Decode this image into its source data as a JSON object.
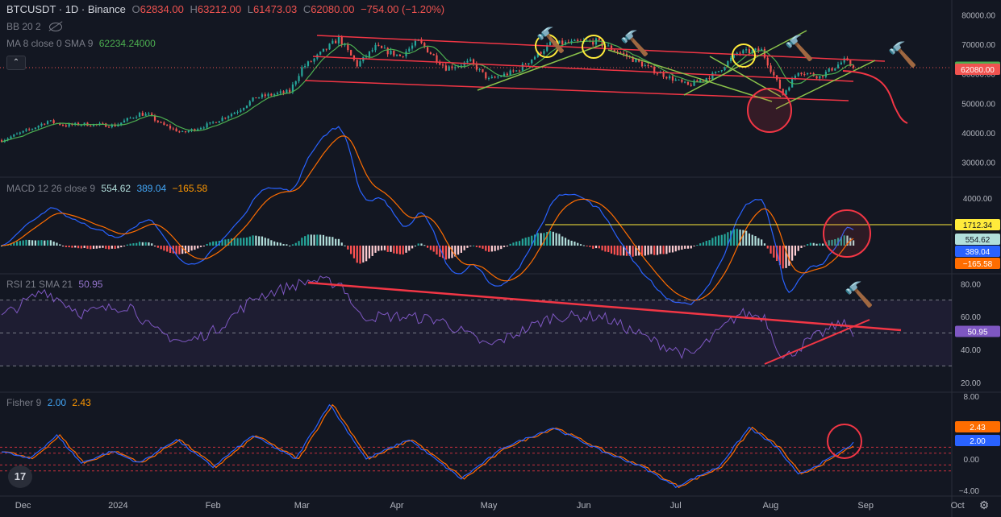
{
  "header": {
    "symbol": "BTCUSDT · 1D · Binance",
    "open_label": "O",
    "open": "62834.00",
    "high_label": "H",
    "high": "63212.00",
    "low_label": "L",
    "low": "61473.03",
    "close_label": "C",
    "close": "62080.00",
    "change": "−754.00 (−1.20%)"
  },
  "indicators": {
    "bb": "BB 20 2",
    "ma": "MA 8 close 0 SMA 9",
    "ma_value": "62234.24000",
    "macd": "MACD 12 26 close 9",
    "macd_v1": "554.62",
    "macd_v2": "389.04",
    "macd_v3": "−165.58",
    "rsi": "RSI 21 SMA 21",
    "rsi_value": "50.95",
    "fisher": "Fisher 9",
    "fisher_v1": "2.00",
    "fisher_v2": "2.43"
  },
  "logo_text": "17",
  "colors": {
    "background": "#131722",
    "up": "#26a69a",
    "down": "#ef5350",
    "channel": "#f23645",
    "trend_green": "#8bc34a",
    "ma": "#4caf50",
    "macd": "#2962ff",
    "signal": "#ff6d00",
    "rsi": "#7e57c2",
    "fisher": "#2962ff",
    "trigger": "#ff6d00",
    "highlight_circle": "#f23645",
    "yellow_circle": "#ffeb3b",
    "level_line": "#ffeb3b"
  },
  "chart_data": [
    {
      "type": "candlestick",
      "title": "BTCUSDT · 1D · Binance",
      "x_ticks": [
        "Dec",
        "2024",
        "Feb",
        "Mar",
        "Apr",
        "May",
        "Jun",
        "Jul",
        "Aug",
        "Sep",
        "Oct"
      ],
      "y_ticks": [
        "80000.00",
        "70000.00",
        "60000.00",
        "50000.00",
        "40000.00",
        "30000.00"
      ],
      "ylim": [
        25000,
        85000
      ],
      "close_path": [
        [
          "2023-11-24",
          37500
        ],
        [
          "2023-12-04",
          41500
        ],
        [
          "2023-12-09",
          44000
        ],
        [
          "2023-12-15",
          42500
        ],
        [
          "2023-12-20",
          43000
        ],
        [
          "2023-12-31",
          42500
        ],
        [
          "2024-01-08",
          46500
        ],
        [
          "2024-01-11",
          46000
        ],
        [
          "2024-01-15",
          43000
        ],
        [
          "2024-01-22",
          40000
        ],
        [
          "2024-01-31",
          43000
        ],
        [
          "2024-02-09",
          47500
        ],
        [
          "2024-02-15",
          52000
        ],
        [
          "2024-02-26",
          54000
        ],
        [
          "2024-03-01",
          62000
        ],
        [
          "2024-03-05",
          65000
        ],
        [
          "2024-03-13",
          72000
        ],
        [
          "2024-03-19",
          63000
        ],
        [
          "2024-03-25",
          69000
        ],
        [
          "2024-04-02",
          66000
        ],
        [
          "2024-04-08",
          71000
        ],
        [
          "2024-04-17",
          62000
        ],
        [
          "2024-04-25",
          64000
        ],
        [
          "2024-05-01",
          58000
        ],
        [
          "2024-05-10",
          61000
        ],
        [
          "2024-05-21",
          70000
        ],
        [
          "2024-06-05",
          71000
        ],
        [
          "2024-06-15",
          66000
        ],
        [
          "2024-06-24",
          61000
        ],
        [
          "2024-07-05",
          56000
        ],
        [
          "2024-07-14",
          60000
        ],
        [
          "2024-07-21",
          67000
        ],
        [
          "2024-07-29",
          68000
        ],
        [
          "2024-08-05",
          53000
        ],
        [
          "2024-08-10",
          61000
        ],
        [
          "2024-08-17",
          59000
        ],
        [
          "2024-08-25",
          64500
        ],
        [
          "2024-08-28",
          62080
        ]
      ],
      "ohlc_last": {
        "open": 62834.0,
        "high": 63212.0,
        "low": 61473.03,
        "close": 62080.0
      },
      "ma_last": 62234.24,
      "price_labels": [
        "62234.2400",
        "62080.00"
      ]
    },
    {
      "type": "line",
      "title": "MACD 12 26 close 9",
      "series": [
        {
          "name": "MACD",
          "last": 389.04
        },
        {
          "name": "Signal",
          "last": 554.62
        },
        {
          "name": "Histogram",
          "last": -165.58
        }
      ],
      "y_ticks": [
        "4000.00"
      ],
      "level": 1712.34,
      "price_labels": [
        "1712.34",
        "554.62",
        "389.04",
        "−165.58"
      ]
    },
    {
      "type": "line",
      "title": "RSI 21 SMA 21",
      "series": [
        {
          "name": "RSI",
          "last": 50.95
        }
      ],
      "y_ticks": [
        "80.00",
        "60.00",
        "40.00",
        "20.00"
      ],
      "ylim": [
        14,
        86
      ],
      "bands": [
        30,
        70
      ],
      "mid": 50,
      "path": [
        [
          "2023-11-24",
          60
        ],
        [
          "2023-12-08",
          76
        ],
        [
          "2023-12-20",
          62
        ],
        [
          "2024-01-05",
          67
        ],
        [
          "2024-01-12",
          52
        ],
        [
          "2024-01-23",
          44
        ],
        [
          "2024-02-02",
          52
        ],
        [
          "2024-02-15",
          72
        ],
        [
          "2024-03-04",
          82
        ],
        [
          "2024-03-14",
          80
        ],
        [
          "2024-03-20",
          60
        ],
        [
          "2024-04-02",
          60
        ],
        [
          "2024-04-15",
          58
        ],
        [
          "2024-05-01",
          42
        ],
        [
          "2024-05-22",
          60
        ],
        [
          "2024-06-07",
          60
        ],
        [
          "2024-06-25",
          44
        ],
        [
          "2024-07-06",
          36
        ],
        [
          "2024-07-22",
          62
        ],
        [
          "2024-07-30",
          60
        ],
        [
          "2024-08-05",
          34
        ],
        [
          "2024-08-14",
          46
        ],
        [
          "2024-08-24",
          56
        ],
        [
          "2024-08-28",
          51
        ]
      ],
      "price_labels": [
        "50.95"
      ]
    },
    {
      "type": "line",
      "title": "Fisher 9",
      "series": [
        {
          "name": "Fisher",
          "last": 2.0
        },
        {
          "name": "Trigger",
          "last": 2.43
        }
      ],
      "y_ticks": [
        "8.00",
        "4.00",
        "0.00",
        "−4.00"
      ],
      "ylim": [
        -4.7,
        8.5
      ],
      "levels": [
        1.5,
        0.75,
        -0.75,
        -1.5
      ],
      "path": [
        [
          "2023-11-24",
          1
        ],
        [
          "2023-12-03",
          0
        ],
        [
          "2023-12-12",
          3
        ],
        [
          "2023-12-20",
          -0.5
        ],
        [
          "2023-12-30",
          1
        ],
        [
          "2024-01-08",
          -0.5
        ],
        [
          "2024-01-20",
          2.5
        ],
        [
          "2024-02-01",
          -1
        ],
        [
          "2024-02-14",
          3
        ],
        [
          "2024-02-28",
          0
        ],
        [
          "2024-03-10",
          7
        ],
        [
          "2024-03-22",
          0
        ],
        [
          "2024-04-05",
          2.5
        ],
        [
          "2024-04-22",
          -2.5
        ],
        [
          "2024-05-06",
          1.5
        ],
        [
          "2024-05-22",
          4
        ],
        [
          "2024-06-07",
          1
        ],
        [
          "2024-06-20",
          -1
        ],
        [
          "2024-07-01",
          -3.5
        ],
        [
          "2024-07-15",
          -1
        ],
        [
          "2024-07-25",
          4
        ],
        [
          "2024-08-03",
          1.5
        ],
        [
          "2024-08-10",
          -2
        ],
        [
          "2024-08-20",
          0
        ],
        [
          "2024-08-28",
          2
        ]
      ],
      "price_labels": [
        "2.43",
        "2.00"
      ]
    }
  ]
}
